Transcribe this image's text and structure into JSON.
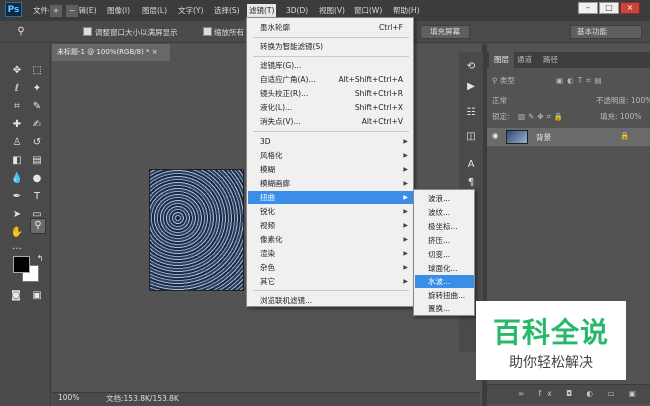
{
  "app": {
    "logo_text": "Ps"
  },
  "menubar": [
    "文件(F)",
    "编辑(E)",
    "图像(I)",
    "图层(L)",
    "文字(Y)",
    "选择(S)",
    "滤镜(T)",
    "3D(D)",
    "视图(V)",
    "窗口(W)",
    "帮助(H)"
  ],
  "options_bar": {
    "zoom_all_label": "调整窗口大小以满屏显示",
    "zoom_partial_label": "缩放所有窗口",
    "fill_screen_label": "填充屏幕",
    "workspace_label": "基本功能"
  },
  "document": {
    "tab_title": "未标题-1 @ 100%(RGB/8) * ×"
  },
  "status": {
    "zoom": "100%",
    "doc_info": "文档:153.8K/153.8K"
  },
  "layers_panel": {
    "tabs": [
      "图层",
      "通道",
      "路径"
    ],
    "kind_label": "类型",
    "blend_mode": "正常",
    "opacity_label": "不透明度: 100%",
    "lock_label": "锁定:",
    "fill_label": "填充: 100%",
    "layer_name": "背景"
  },
  "filter_menu": {
    "items": [
      {
        "label": "墨水轮廓",
        "shortcut": "Ctrl+F"
      },
      {
        "label": "转换为智能滤镜(S)",
        "shortcut": ""
      },
      {
        "label": "滤镜库(G)...",
        "shortcut": ""
      },
      {
        "label": "自适应广角(A)...",
        "shortcut": "Alt+Shift+Ctrl+A"
      },
      {
        "label": "镜头校正(R)...",
        "shortcut": "Shift+Ctrl+R"
      },
      {
        "label": "液化(L)...",
        "shortcut": "Shift+Ctrl+X"
      },
      {
        "label": "消失点(V)...",
        "shortcut": "Alt+Ctrl+V"
      },
      {
        "label": "3D",
        "shortcut": ""
      },
      {
        "label": "风格化",
        "shortcut": ""
      },
      {
        "label": "模糊",
        "shortcut": ""
      },
      {
        "label": "模糊画廊",
        "shortcut": ""
      },
      {
        "label": "扭曲",
        "shortcut": ""
      },
      {
        "label": "锐化",
        "shortcut": ""
      },
      {
        "label": "视频",
        "shortcut": ""
      },
      {
        "label": "像素化",
        "shortcut": ""
      },
      {
        "label": "渲染",
        "shortcut": ""
      },
      {
        "label": "杂色",
        "shortcut": ""
      },
      {
        "label": "其它",
        "shortcut": ""
      },
      {
        "label": "浏览联机滤镜...",
        "shortcut": ""
      }
    ]
  },
  "distort_submenu": {
    "items": [
      "波浪...",
      "波纹...",
      "极坐标...",
      "挤压...",
      "切变...",
      "球面化...",
      "水波...",
      "旋转扭曲...",
      "置换..."
    ],
    "highlighted": "水波..."
  },
  "watermark": {
    "title": "百科全说",
    "subtitle": "助你轻松解决"
  }
}
